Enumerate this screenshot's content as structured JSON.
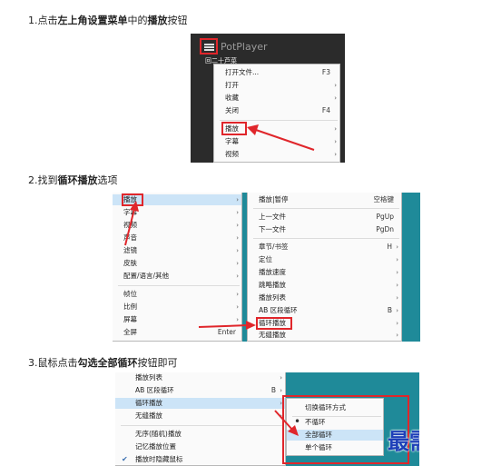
{
  "steps": {
    "s1": {
      "pre": "1.点击",
      "bold": "左上角设置菜单",
      "post": "中的",
      "bold2": "播放",
      "end": "按钮"
    },
    "s2": {
      "pre": "2.找到",
      "bold": "循环播放",
      "post": "选项"
    },
    "s3": {
      "pre": "3.鼠标点击",
      "bold": "勾选全部循环",
      "post": "按钮即可"
    }
  },
  "shot1": {
    "app_title": "PotPlayer",
    "cut_label": "回二十芦菜",
    "items": [
      {
        "label": "打开文件...",
        "shortcut": "F3"
      },
      {
        "label": "打开",
        "arrow": "›"
      },
      {
        "label": "收藏",
        "arrow": "›"
      },
      {
        "label": "关闭",
        "shortcut": "F4"
      },
      {
        "label": "播放",
        "arrow": "›"
      },
      {
        "label": "字幕",
        "arrow": "›"
      },
      {
        "label": "视频",
        "arrow": "›"
      }
    ]
  },
  "shot2": {
    "left_items": [
      {
        "label": "播放",
        "arrow": "›"
      },
      {
        "label": "字幕",
        "arrow": "›"
      },
      {
        "label": "视频",
        "arrow": "›"
      },
      {
        "label": "声音",
        "arrow": "›"
      },
      {
        "label": "滤镜",
        "arrow": "›"
      },
      {
        "label": "皮肤",
        "arrow": "›"
      },
      {
        "label": "配置/语言/其他",
        "arrow": "›"
      },
      {
        "label": "帧位",
        "arrow": "›"
      },
      {
        "label": "比例",
        "arrow": "›"
      },
      {
        "label": "屏幕",
        "arrow": "›"
      },
      {
        "label": "全屏",
        "shortcut": "Enter"
      }
    ],
    "right_items": [
      {
        "label": "播放|暂停",
        "shortcut": "空格键"
      },
      {
        "label": "上一文件",
        "shortcut": "PgUp"
      },
      {
        "label": "下一文件",
        "shortcut": "PgDn"
      },
      {
        "label": "章节/书签",
        "shortcut": "H",
        "arrow": "›"
      },
      {
        "label": "定位",
        "arrow": "›"
      },
      {
        "label": "播放速度",
        "arrow": "›"
      },
      {
        "label": "跳略播放",
        "arrow": "›"
      },
      {
        "label": "播放列表",
        "arrow": "›"
      },
      {
        "label": "AB 区段循环",
        "shortcut": "B",
        "arrow": "›"
      },
      {
        "label": "循环播放",
        "arrow": "›"
      },
      {
        "label": "无缝播放",
        "arrow": "›"
      }
    ]
  },
  "shot3": {
    "left_items": [
      {
        "label": "播放列表",
        "arrow": "›"
      },
      {
        "label": "AB 区段循环",
        "shortcut": "B",
        "arrow": "›"
      },
      {
        "label": "循环播放",
        "arrow": "›"
      },
      {
        "label": "无缝播放",
        "arrow": "›"
      },
      {
        "label": "无序(随机)播放"
      },
      {
        "label": "记忆播放位置"
      },
      {
        "label": "播放时隐藏鼠标"
      }
    ],
    "submenu": [
      {
        "label": "切换循环方式"
      },
      {
        "label": "不循环"
      },
      {
        "label": "全部循环"
      },
      {
        "label": "单个循环"
      }
    ],
    "check_glyph": "✔",
    "radio_glyph": "•",
    "watermark": "最需教育"
  },
  "colors": {
    "accent_red": "#e0262b",
    "highlight": "#cce4f7",
    "desktop_teal": "#1f8a99"
  }
}
